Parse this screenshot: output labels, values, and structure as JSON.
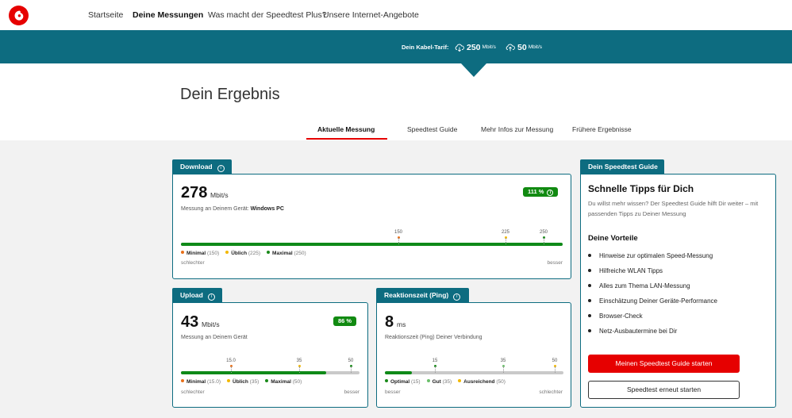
{
  "nav": {
    "logo_icon": "vodafone-speechmark-icon",
    "items": [
      "Startseite",
      "Deine Messungen",
      "Was macht der Speedtest Plus?",
      "Unsere Internet-Angebote"
    ]
  },
  "tarif": {
    "label": "Dein Kabel-Tarif:",
    "download_value": "250",
    "download_unit": "Mbit/s",
    "upload_value": "50",
    "upload_unit": "Mbit/s",
    "download_icon": "cloud-download-icon",
    "upload_icon": "cloud-upload-icon"
  },
  "page_title": "Dein Ergebnis",
  "tabs": [
    "Aktuelle Messung",
    "Speedtest Guide",
    "Mehr Infos zur Messung",
    "Frühere Ergebnisse"
  ],
  "download": {
    "title": "Download",
    "value": "278",
    "unit": "Mbit/s",
    "subtitle_prefix": "Messung an Deinem Gerät:",
    "device": "Windows PC",
    "badge": "111 %",
    "fill_fraction": 1.0,
    "ticks": [
      {
        "label": "150",
        "color": "#e8701a",
        "pos": 0.57
      },
      {
        "label": "225",
        "color": "#f2b800",
        "pos": 0.85
      },
      {
        "label": "250",
        "color": "#1a8a1a",
        "pos": 0.95
      }
    ],
    "legend": [
      {
        "name": "Minimal",
        "val": "(150)",
        "color": "#e8701a"
      },
      {
        "name": "Üblich",
        "val": "(225)",
        "color": "#f2b800"
      },
      {
        "name": "Maximal",
        "val": "(250)",
        "color": "#1a8a1a"
      }
    ],
    "left_word": "schlechter",
    "right_word": "besser"
  },
  "upload": {
    "title": "Upload",
    "value": "43",
    "unit": "Mbit/s",
    "subtitle": "Messung an Deinem Gerät",
    "badge": "86 %",
    "fill_fraction": 0.815,
    "ticks": [
      {
        "label": "15.0",
        "color": "#e8701a",
        "pos": 0.28
      },
      {
        "label": "35",
        "color": "#f2b800",
        "pos": 0.66
      },
      {
        "label": "50",
        "color": "#1a8a1a",
        "pos": 0.95
      }
    ],
    "legend": [
      {
        "name": "Minimal",
        "val": "(15.0)",
        "color": "#e8701a"
      },
      {
        "name": "Üblich",
        "val": "(35)",
        "color": "#f2b800"
      },
      {
        "name": "Maximal",
        "val": "(50)",
        "color": "#1a8a1a"
      }
    ],
    "left_word": "schlechter",
    "right_word": "besser"
  },
  "ping": {
    "title": "Reaktionszeit (Ping)",
    "value": "8",
    "unit": "ms",
    "subtitle": "Reaktionszeit (Ping) Deiner Verbindung",
    "fill_fraction": 0.15,
    "ticks": [
      {
        "label": "15",
        "color": "#1a8a1a",
        "pos": 0.28
      },
      {
        "label": "35",
        "color": "#6bbf6b",
        "pos": 0.66
      },
      {
        "label": "50",
        "color": "#f2b800",
        "pos": 0.95
      }
    ],
    "legend": [
      {
        "name": "Optimal",
        "val": "(15)",
        "color": "#1a8a1a"
      },
      {
        "name": "Gut",
        "val": "(35)",
        "color": "#6bbf6b"
      },
      {
        "name": "Ausreichend",
        "val": "(50)",
        "color": "#f2b800"
      }
    ],
    "left_word": "besser",
    "right_word": "schlechter"
  },
  "guide": {
    "tab": "Dein Speedtest Guide",
    "heading": "Schnelle Tipps für Dich",
    "text": "Du willst mehr wissen? Der Speedtest Guide hilft Dir weiter – mit passenden Tipps zu Deiner Messung",
    "benefits_heading": "Deine Vorteile",
    "benefits": [
      "Hinweise zur optimalen Speed-Messung",
      "Hilfreiche WLAN Tipps",
      "Alles zum Thema LAN-Messung",
      "Einschätzung Deiner Geräte-Performance",
      "Browser-Check",
      "Netz-Ausbautermine bei Dir"
    ],
    "primary_button": "Meinen Speedtest Guide starten",
    "secondary_button": "Speedtest erneut starten"
  },
  "colors": {
    "teal": "#0d6c80",
    "red": "#e60000",
    "green": "#0f8a18"
  }
}
